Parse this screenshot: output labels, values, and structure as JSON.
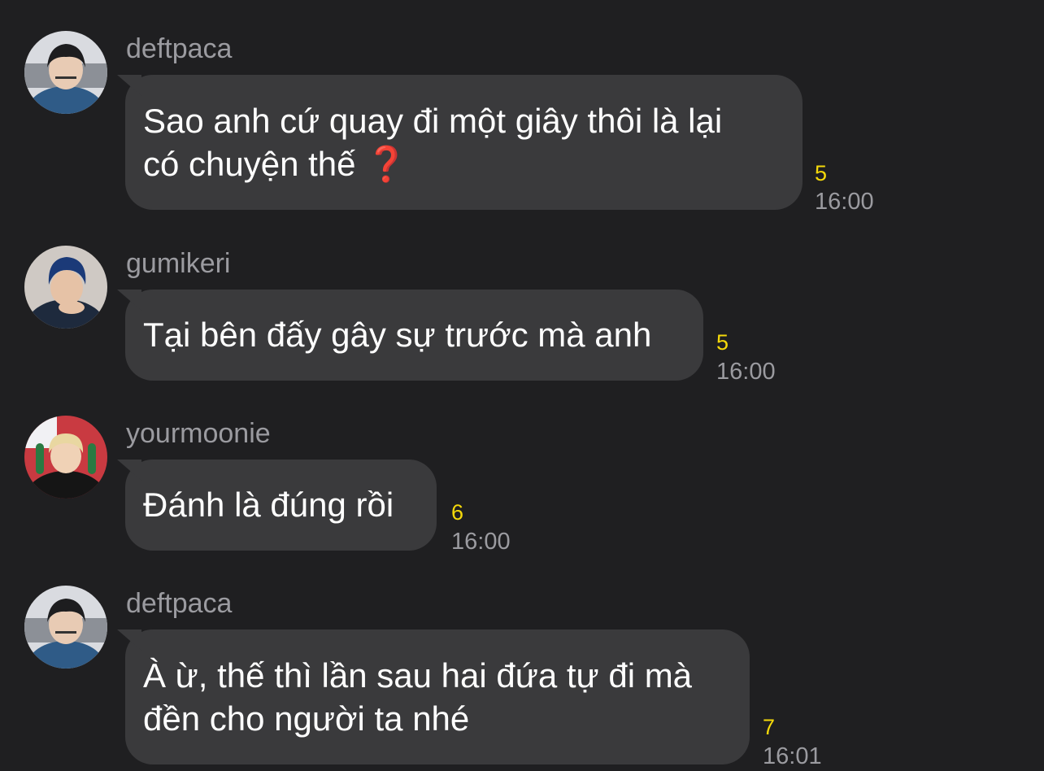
{
  "messages": [
    {
      "sender": "deftpaca",
      "lines": [
        "Sao anh cứ quay đi một giây thôi là lại",
        "có chuyện thế"
      ],
      "has_question_emoji": true,
      "read_count": "5",
      "time": "16:00"
    },
    {
      "sender": "gumikeri",
      "lines": [
        "Tại bên đấy gây sự trước mà anh"
      ],
      "read_count": "5",
      "time": "16:00"
    },
    {
      "sender": "yourmoonie",
      "lines": [
        "Đánh là đúng rồi"
      ],
      "read_count": "6",
      "time": "16:00"
    },
    {
      "sender": "deftpaca",
      "lines": [
        "À ừ, thế thì lần sau hai đứa tự đi mà",
        "đền cho người ta nhé"
      ],
      "read_count": "7",
      "time": "16:01"
    }
  ],
  "emoji": {
    "question": "❓"
  },
  "colors": {
    "background": "#1f1f21",
    "bubble": "#3a3a3c",
    "read_count": "#f5d90a",
    "meta": "#9b9ba0"
  }
}
